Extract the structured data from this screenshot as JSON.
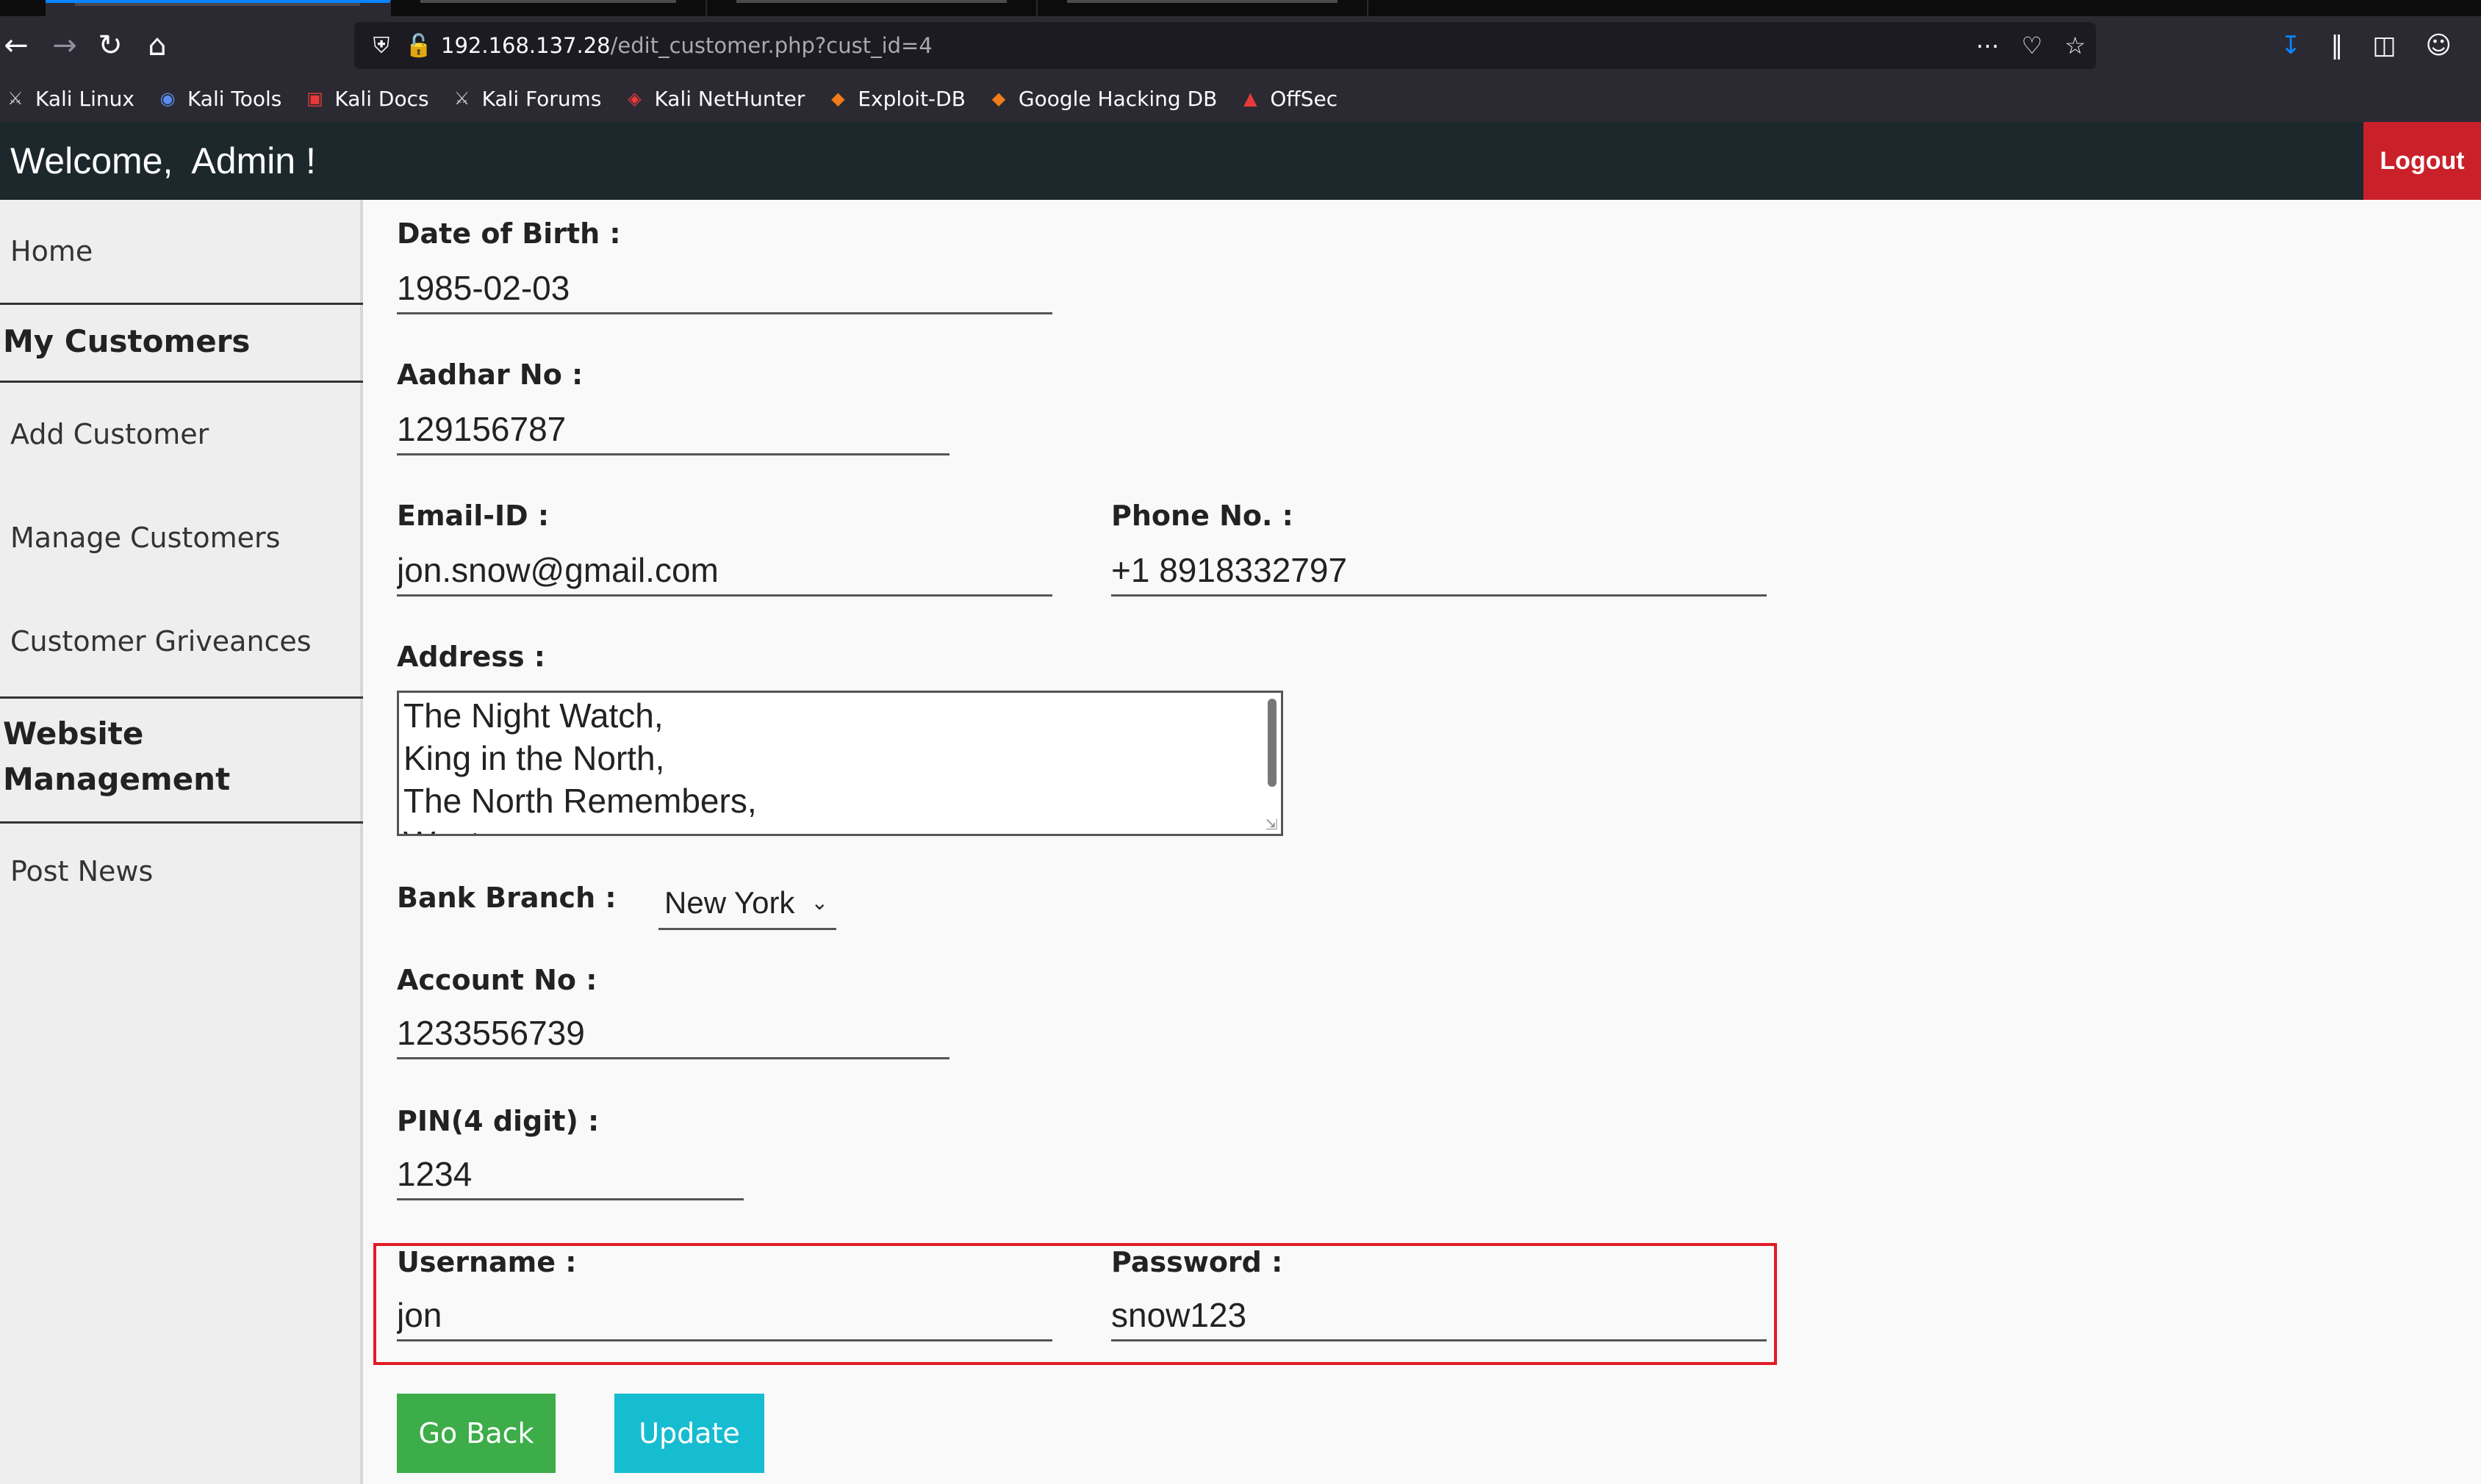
{
  "browser": {
    "url_host": "192.168.137.28",
    "url_path": "/edit_customer.php?cust_id=4",
    "bookmarks": [
      {
        "label": "Kali Linux",
        "icon": "kali-dragon-icon",
        "color": "#cccccc"
      },
      {
        "label": "Kali Tools",
        "icon": "kali-tools-icon",
        "color": "#5b8def"
      },
      {
        "label": "Kali Docs",
        "icon": "kali-docs-icon",
        "color": "#e83a3a"
      },
      {
        "label": "Kali Forums",
        "icon": "kali-forums-icon",
        "color": "#cccccc"
      },
      {
        "label": "Kali NetHunter",
        "icon": "nethunter-icon",
        "color": "#e83a3a"
      },
      {
        "label": "Exploit-DB",
        "icon": "exploit-db-icon",
        "color": "#f07c1b"
      },
      {
        "label": "Google Hacking DB",
        "icon": "ghdb-icon",
        "color": "#f07c1b"
      },
      {
        "label": "OffSec",
        "icon": "offsec-icon",
        "color": "#e83a3a"
      }
    ]
  },
  "header": {
    "welcome": "Welcome,  Admin !",
    "logout_label": "Logout"
  },
  "sidebar": {
    "home": "Home",
    "section_customers": "My Customers",
    "add_customer": "Add Customer",
    "manage_customers": "Manage Customers",
    "grievances": "Customer Griveances",
    "section_website_line1": "Website",
    "section_website_line2": "Management",
    "post_news": "Post News"
  },
  "form": {
    "dob_label": "Date of Birth :",
    "dob_value": "1985-02-03",
    "aadhar_label": "Aadhar No :",
    "aadhar_value": "129156787",
    "email_label": "Email-ID :",
    "email_value": "jon.snow@gmail.com",
    "phone_label": "Phone No. :",
    "phone_value": "+1 8918332797",
    "address_label": "Address :",
    "address_value": "The Night Watch,\nKing in the North,\nThe North Remembers,\nWest",
    "branch_label": "Bank Branch :",
    "branch_value": "New York",
    "account_label": "Account No :",
    "account_value": "1233556739",
    "pin_label": "PIN(4 digit) :",
    "pin_value": "1234",
    "username_label": "Username :",
    "username_value": "jon",
    "password_label": "Password :",
    "password_value": "snow123"
  },
  "buttons": {
    "back": "Go Back",
    "update": "Update"
  },
  "colors": {
    "header_bg": "#1c282c",
    "logout_bg": "#c9202a",
    "back_bg": "#3cad49",
    "update_bg": "#16bcd0",
    "highlight_border": "#e21b26"
  }
}
